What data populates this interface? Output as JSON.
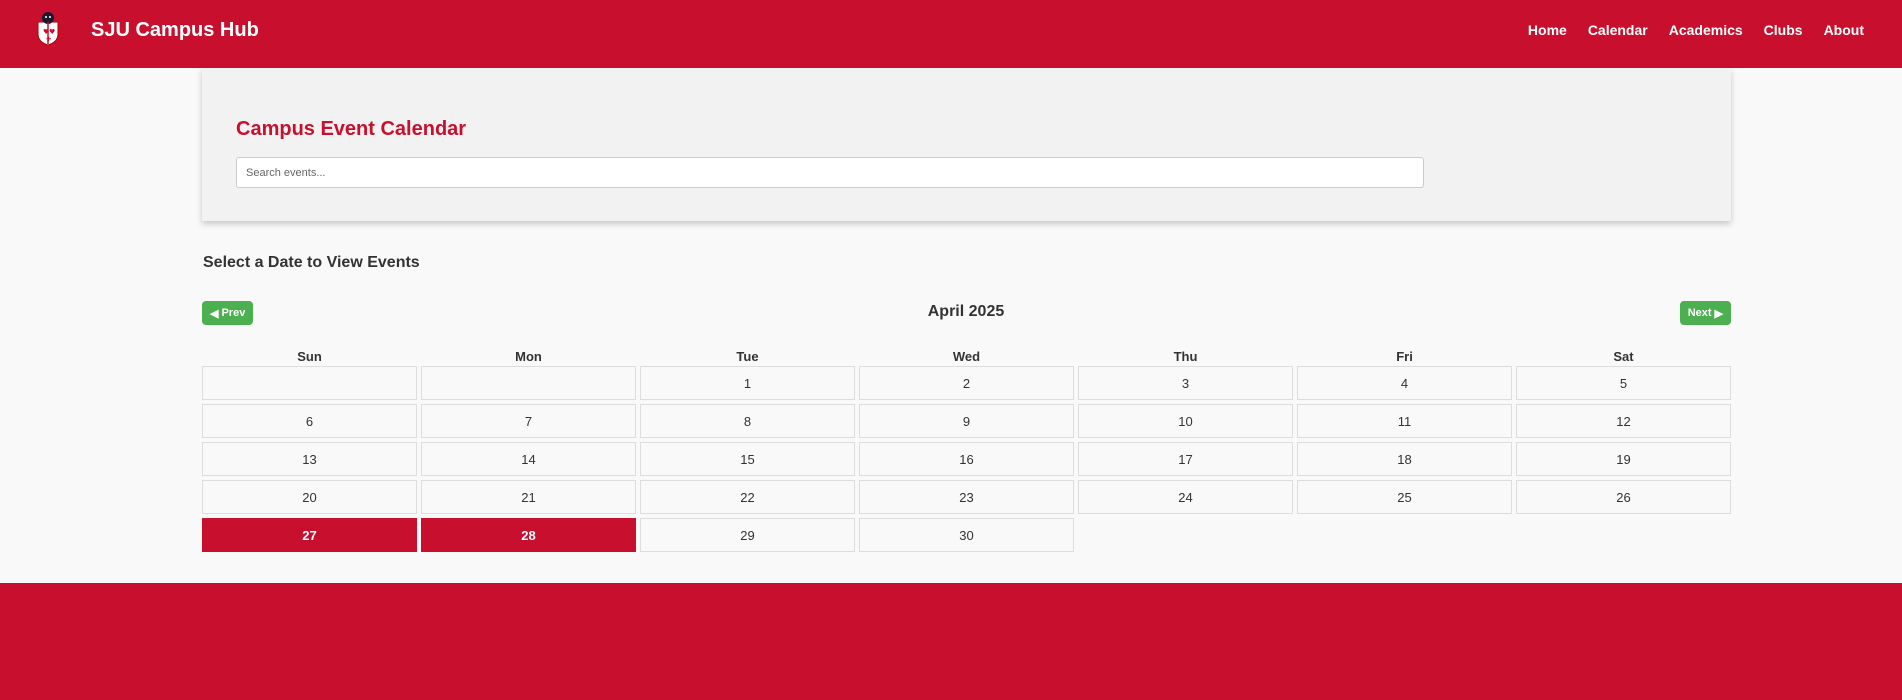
{
  "header": {
    "title": "SJU Campus Hub",
    "logo_icon": "hawk-shield-logo-icon",
    "nav": [
      "Home",
      "Calendar",
      "Academics",
      "Clubs",
      "About"
    ]
  },
  "hero": {
    "title": "Campus Event Calendar",
    "search_placeholder": "Search events...",
    "search_value": ""
  },
  "calendar": {
    "section_title": "Select a Date to View Events",
    "prev_label": "Prev",
    "next_label": "Next",
    "prev_icon": "triangle-left-icon",
    "next_icon": "triangle-right-icon",
    "month_label": "April 2025",
    "weekdays": [
      "Sun",
      "Mon",
      "Tue",
      "Wed",
      "Thu",
      "Fri",
      "Sat"
    ],
    "leading_blank_days": 2,
    "days_in_month": 30,
    "highlighted_days": [
      27,
      28
    ]
  },
  "colors": {
    "brand_red": "#c8102e",
    "button_green": "#4caf50"
  }
}
